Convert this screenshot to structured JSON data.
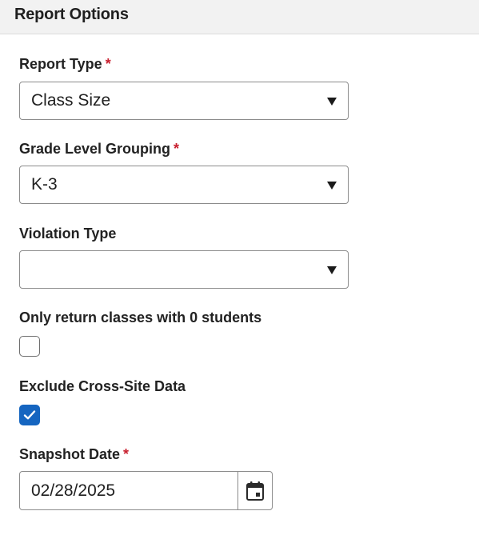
{
  "header": {
    "title": "Report Options"
  },
  "fields": {
    "report_type": {
      "label": "Report Type",
      "required_mark": "*",
      "value": "Class Size"
    },
    "grade_level_grouping": {
      "label": "Grade Level Grouping",
      "required_mark": "*",
      "value": "K-3"
    },
    "violation_type": {
      "label": "Violation Type",
      "value": ""
    },
    "only_zero_students": {
      "label": "Only return classes with 0 students",
      "checked": false
    },
    "exclude_cross_site": {
      "label": "Exclude Cross-Site Data",
      "checked": true
    },
    "snapshot_date": {
      "label": "Snapshot Date",
      "required_mark": "*",
      "value": "02/28/2025"
    }
  },
  "icons": {
    "dropdown": "chevron-down-icon",
    "calendar": "calendar-icon",
    "check": "checkmark-icon"
  },
  "colors": {
    "required": "#c8202f",
    "checkbox_checked": "#1565c0",
    "header_bg": "#f2f2f2"
  }
}
